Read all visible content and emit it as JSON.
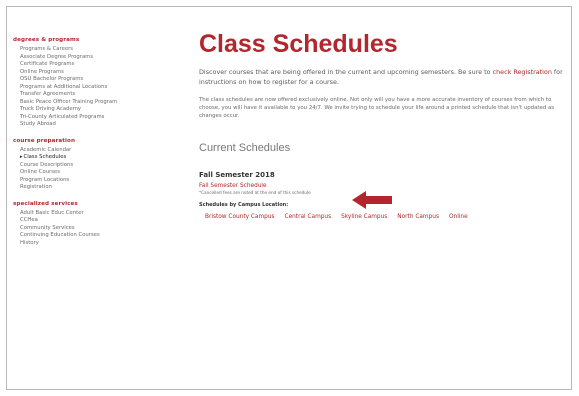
{
  "sidebar": {
    "groups": [
      {
        "heading": "degrees & programs",
        "items": [
          {
            "label": "Programs & Careers"
          },
          {
            "label": "Associate Degree Programs"
          },
          {
            "label": "Certificate Programs"
          },
          {
            "label": "Online Programs"
          },
          {
            "label": "OSU Bachelor Programs"
          },
          {
            "label": "Programs at Additional Locations"
          },
          {
            "label": "Transfer Agreements"
          },
          {
            "label": "Basic Peace Officer Training Program"
          },
          {
            "label": "Truck Driving Academy"
          },
          {
            "label": "Tri-County Articulated Programs"
          },
          {
            "label": "Study Abroad"
          }
        ]
      },
      {
        "heading": "course preparation",
        "items": [
          {
            "label": "Academic Calendar"
          },
          {
            "label": "Class Schedules",
            "active": true
          },
          {
            "label": "Course Descriptions"
          },
          {
            "label": "Online Courses"
          },
          {
            "label": "Program Locations"
          },
          {
            "label": "Registration"
          }
        ]
      },
      {
        "heading": "specialized services",
        "items": [
          {
            "label": "Adult Basic Educ Center"
          },
          {
            "label": "CCHea"
          },
          {
            "label": "Community Services"
          },
          {
            "label": "Continuing Education Courses"
          },
          {
            "label": "History"
          }
        ]
      }
    ]
  },
  "main": {
    "title": "Class Schedules",
    "intro_before": "Discover courses that are being offered in the current and upcoming semesters. Be sure to ",
    "intro_link": "check Registration",
    "intro_after": " for instructions on how to register for a course.",
    "note": "The class schedules are now offered exclusively online. Not only will you have a more accurate inventory of courses from which to choose, you will have it available to you 24/7. We invite trying to schedule your life around a printed schedule that isn't updated as changes occur.",
    "current_heading": "Current Schedules",
    "semester_heading": "Fall Semester 2018",
    "fall_link": "Fall Semester Schedule",
    "small_note": "*Cancelled fees are noted at the end of this schedule",
    "by_location_label": "Schedules by Campus Location:",
    "campuses": [
      {
        "label": "Bristow County Campus"
      },
      {
        "label": "Central Campus"
      },
      {
        "label": "Skyline Campus"
      },
      {
        "label": "North Campus"
      },
      {
        "label": "Online"
      }
    ]
  },
  "colors": {
    "accent": "#b3262e",
    "arrow": "#b3262e"
  },
  "icons": {
    "arrow": "left-arrow-icon"
  }
}
